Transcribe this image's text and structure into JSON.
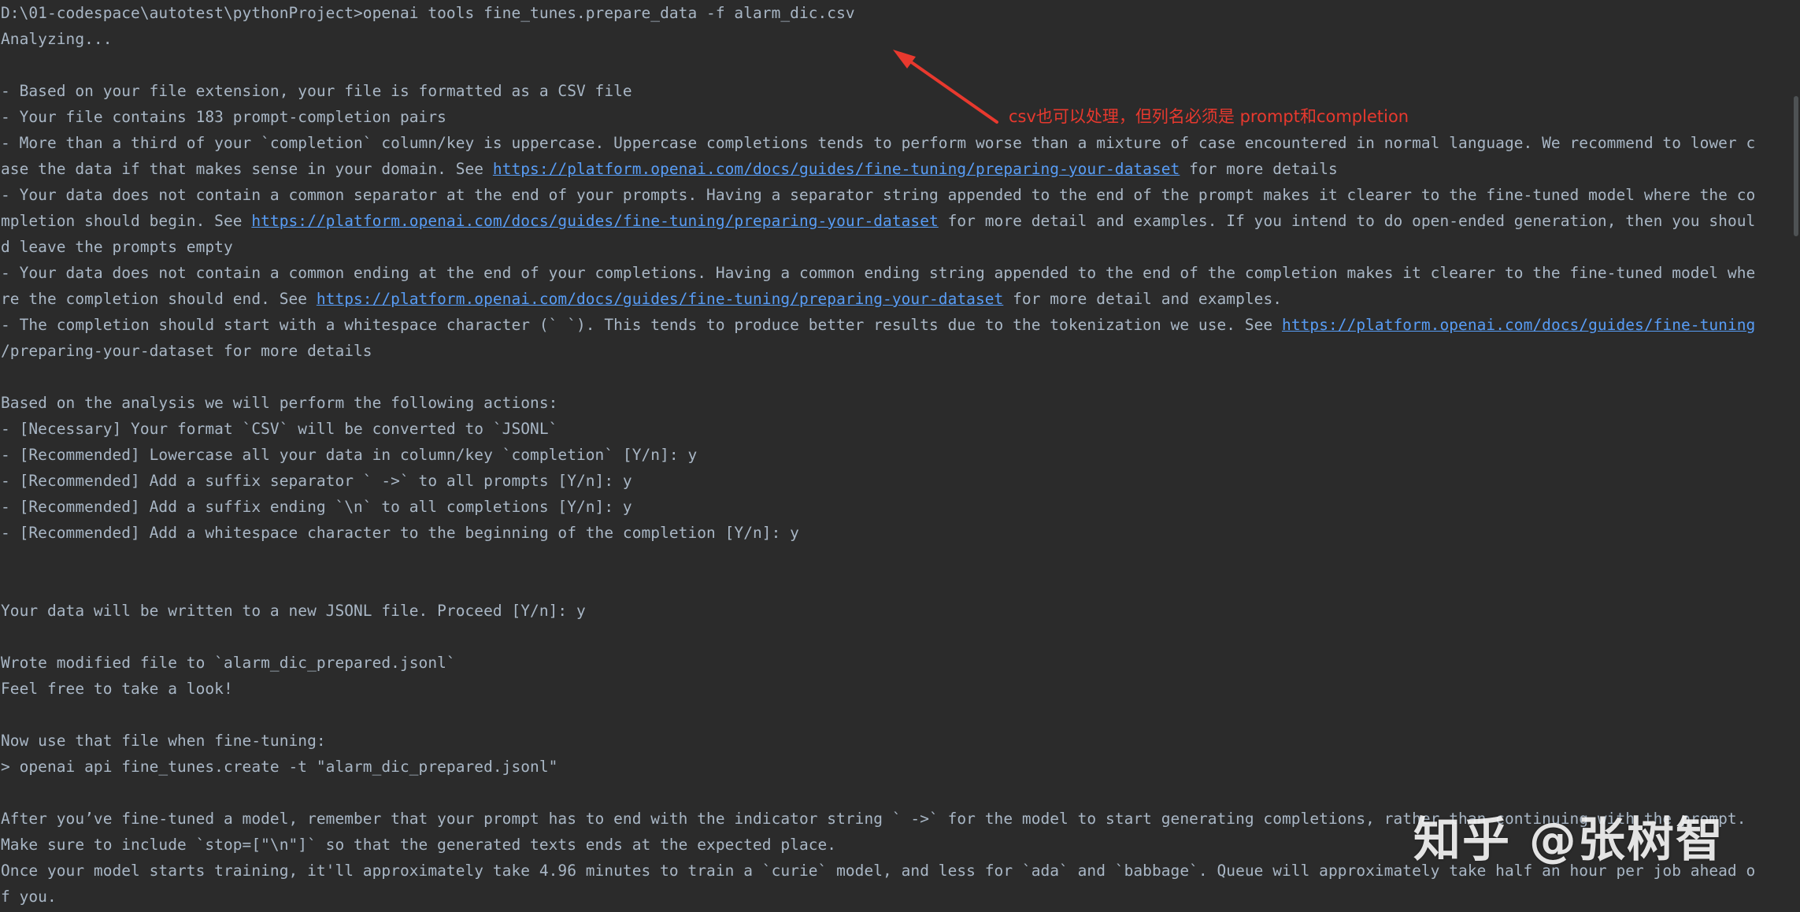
{
  "terminal": {
    "lines": [
      {
        "segments": [
          {
            "text": "D:\\01-codespace\\autotest\\pythonProject>openai tools fine_tunes.prepare_data -f alarm_dic.csv"
          }
        ]
      },
      {
        "segments": [
          {
            "text": "Analyzing..."
          }
        ]
      },
      {
        "segments": []
      },
      {
        "segments": [
          {
            "text": "- Based on your file extension, your file is formatted as a CSV file"
          }
        ]
      },
      {
        "segments": [
          {
            "text": "- Your file contains 183 prompt-completion pairs"
          }
        ]
      },
      {
        "segments": [
          {
            "text": "- More than a third of your `completion` column/key is uppercase. Uppercase completions tends to perform worse than a mixture of case encountered in normal language. We recommend to lower c"
          }
        ]
      },
      {
        "segments": [
          {
            "text": "ase the data if that makes sense in your domain. See "
          },
          {
            "text": "https://platform.openai.com/docs/guides/fine-tuning/preparing-your-dataset",
            "link": true
          },
          {
            "text": " for more details"
          }
        ]
      },
      {
        "segments": [
          {
            "text": "- Your data does not contain a common separator at the end of your prompts. Having a separator string appended to the end of the prompt makes it clearer to the fine-tuned model where the co"
          }
        ]
      },
      {
        "segments": [
          {
            "text": "mpletion should begin. See "
          },
          {
            "text": "https://platform.openai.com/docs/guides/fine-tuning/preparing-your-dataset",
            "link": true
          },
          {
            "text": " for more detail and examples. If you intend to do open-ended generation, then you shoul"
          }
        ]
      },
      {
        "segments": [
          {
            "text": "d leave the prompts empty"
          }
        ]
      },
      {
        "segments": [
          {
            "text": "- Your data does not contain a common ending at the end of your completions. Having a common ending string appended to the end of the completion makes it clearer to the fine-tuned model whe"
          }
        ]
      },
      {
        "segments": [
          {
            "text": "re the completion should end. See "
          },
          {
            "text": "https://platform.openai.com/docs/guides/fine-tuning/preparing-your-dataset",
            "link": true
          },
          {
            "text": " for more detail and examples."
          }
        ]
      },
      {
        "segments": [
          {
            "text": "- The completion should start with a whitespace character (` `). This tends to produce better results due to the tokenization we use. See "
          },
          {
            "text": "https://platform.openai.com/docs/guides/fine-tuning",
            "link": true
          }
        ]
      },
      {
        "segments": [
          {
            "text": "/preparing-your-dataset for more details"
          }
        ]
      },
      {
        "segments": []
      },
      {
        "segments": [
          {
            "text": "Based on the analysis we will perform the following actions:"
          }
        ]
      },
      {
        "segments": [
          {
            "text": "- [Necessary] Your format `CSV` will be converted to `JSONL`"
          }
        ]
      },
      {
        "segments": [
          {
            "text": "- [Recommended] Lowercase all your data in column/key `completion` [Y/n]: y"
          }
        ]
      },
      {
        "segments": [
          {
            "text": "- [Recommended] Add a suffix separator ` ->` to all prompts [Y/n]: y"
          }
        ]
      },
      {
        "segments": [
          {
            "text": "- [Recommended] Add a suffix ending `\\n` to all completions [Y/n]: y"
          }
        ]
      },
      {
        "segments": [
          {
            "text": "- [Recommended] Add a whitespace character to the beginning of the completion [Y/n]: y"
          }
        ]
      },
      {
        "segments": []
      },
      {
        "segments": []
      },
      {
        "segments": [
          {
            "text": "Your data will be written to a new JSONL file. Proceed [Y/n]: y"
          }
        ]
      },
      {
        "segments": []
      },
      {
        "segments": [
          {
            "text": "Wrote modified file to `alarm_dic_prepared.jsonl`"
          }
        ]
      },
      {
        "segments": [
          {
            "text": "Feel free to take a look!"
          }
        ]
      },
      {
        "segments": []
      },
      {
        "segments": [
          {
            "text": "Now use that file when fine-tuning:"
          }
        ]
      },
      {
        "segments": [
          {
            "text": "> openai api fine_tunes.create -t \"alarm_dic_prepared.jsonl\""
          }
        ]
      },
      {
        "segments": []
      },
      {
        "segments": [
          {
            "text": "After you’ve fine-tuned a model, remember that your prompt has to end with the indicator string ` ->` for the model to start generating completions, rather than continuing with the prompt."
          }
        ]
      },
      {
        "segments": [
          {
            "text": "Make sure to include `stop=[\"\\n\"]` so that the generated texts ends at the expected place."
          }
        ]
      },
      {
        "segments": [
          {
            "text": "Once your model starts training, it'll approximately take 4.96 minutes to train a `curie` model, and less for `ada` and `babbage`. Queue will approximately take half an hour per job ahead o"
          }
        ]
      },
      {
        "segments": [
          {
            "text": "f you."
          }
        ]
      }
    ]
  },
  "annotation": {
    "text": "csv也可以处理，但列名必须是  prompt和completion",
    "color": "#e8392e"
  },
  "watermark": {
    "text": "知乎 @张树智"
  },
  "colors": {
    "background": "#2b2b2b",
    "text": "#a9b7c6",
    "link": "#589df6",
    "annotation": "#e8392e"
  }
}
